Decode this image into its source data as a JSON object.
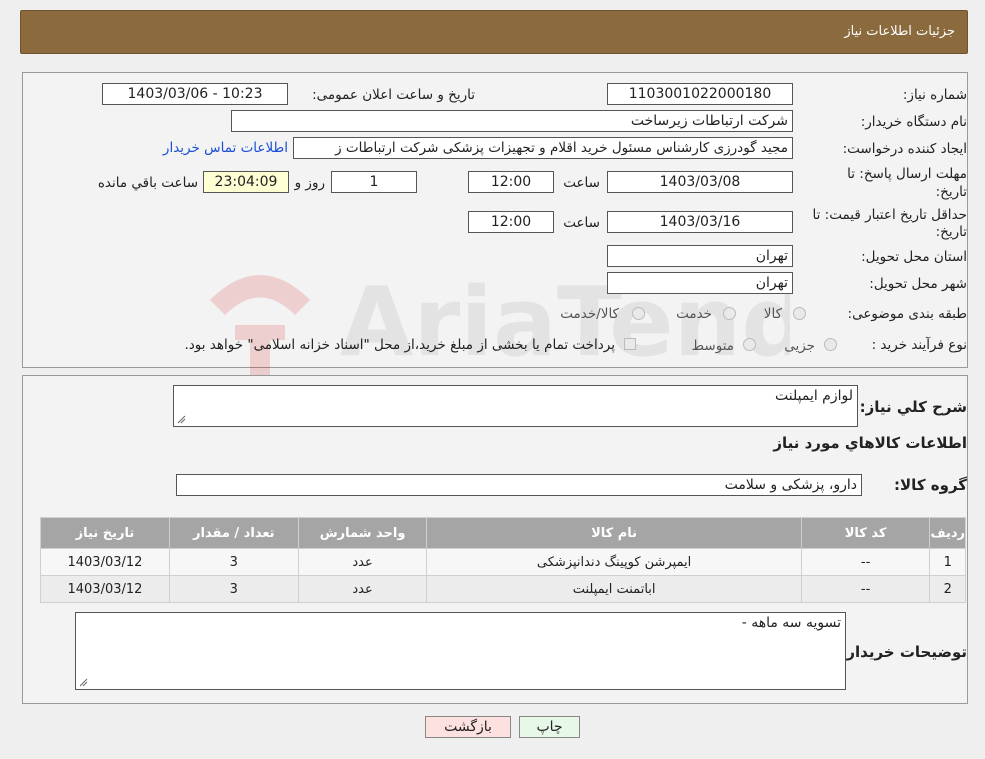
{
  "header": {
    "title": "جزئیات اطلاعات نیاز"
  },
  "form": {
    "need_number_label": "شماره نیاز:",
    "need_number": "1103001022000180",
    "announce_label": "تاریخ و ساعت اعلان عمومی:",
    "announce_value": "1403/03/06 - 10:23",
    "buyer_label": "نام دستگاه خریدار:",
    "buyer_value": "شرکت ارتباطات زیرساخت",
    "creator_label": "ایجاد کننده درخواست:",
    "creator_value": "مجید گودرزی کارشناس مسئول خرید اقلام و تجهیزات پزشکی شرکت ارتباطات ز",
    "contact_link": "اطلاعات تماس خریدار",
    "deadline_label_1": "مهلت ارسال پاسخ: تا",
    "deadline_label_2": "تاریخ:",
    "deadline_date": "1403/03/08",
    "time_label": "ساعت",
    "deadline_time": "12:00",
    "days_value": "1",
    "days_label": "روز و",
    "remaining_time": "23:04:09",
    "remaining_label": "ساعت باقي مانده",
    "validity_label_1": "حداقل تاریخ اعتبار قیمت: تا",
    "validity_label_2": "تاریخ:",
    "validity_date": "1403/03/16",
    "validity_time": "12:00",
    "province_label": "استان محل تحویل:",
    "province_value": "تهران",
    "city_label": "شهر محل تحویل:",
    "city_value": "تهران",
    "category_label": "طبقه بندی موضوعی:",
    "category_options": [
      "کالا",
      "خدمت",
      "کالا/خدمت"
    ],
    "process_label": "نوع فرآیند خرید :",
    "process_options": [
      "جزیی",
      "متوسط"
    ],
    "payment_note": "پرداخت تمام یا بخشی از مبلغ خرید،از محل \"اسناد خزانه اسلامی\" خواهد بود."
  },
  "details": {
    "summary_label": "شرح کلي نياز:",
    "summary_value": "لوازم ایمپلنت",
    "items_title": "اطلاعات کالاهاي مورد نياز",
    "group_label": "گروه کالا:",
    "group_value": "دارو، پزشکی و سلامت",
    "table": {
      "headers": [
        "رديف",
        "کد کالا",
        "نام کالا",
        "واحد شمارش",
        "تعداد / مقدار",
        "تاریخ نیاز"
      ],
      "rows": [
        [
          "1",
          "--",
          "ایمپرشن کوپینگ دندانپزشکی",
          "عدد",
          "3",
          "1403/03/12"
        ],
        [
          "2",
          "--",
          "اباتمنت ایمپلنت",
          "عدد",
          "3",
          "1403/03/12"
        ]
      ]
    },
    "buyer_notes_label": "توضیحات خریدار:",
    "buyer_notes_value": "تسویه سه ماهه -"
  },
  "buttons": {
    "print": "چاپ",
    "back": "بازگشت"
  },
  "colors": {
    "header_bg": "#8b6a3e",
    "link": "#1a4fd6",
    "remaining_bg": "#ffffd4"
  }
}
